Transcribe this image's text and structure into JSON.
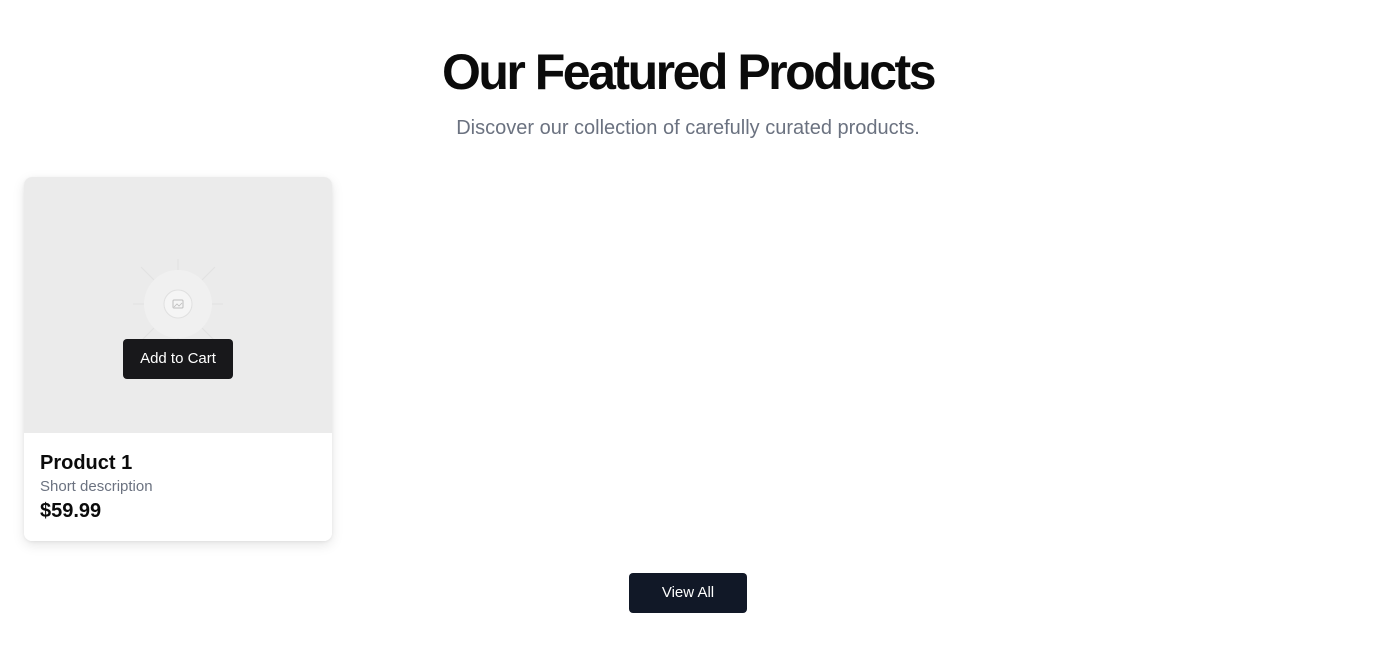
{
  "header": {
    "title": "Our Featured Products",
    "subtitle": "Discover our collection of carefully curated products."
  },
  "products": [
    {
      "name": "Product 1",
      "description": "Short description",
      "price": "$59.99",
      "add_to_cart_label": "Add to Cart",
      "image_icon": "image-placeholder-icon"
    }
  ],
  "actions": {
    "view_all_label": "View All"
  },
  "colors": {
    "title": "#0b0b0b",
    "subtitle": "#6b7280",
    "card_image_bg": "#ebebeb",
    "add_to_cart_bg": "#18181b",
    "view_all_bg": "#111827"
  }
}
